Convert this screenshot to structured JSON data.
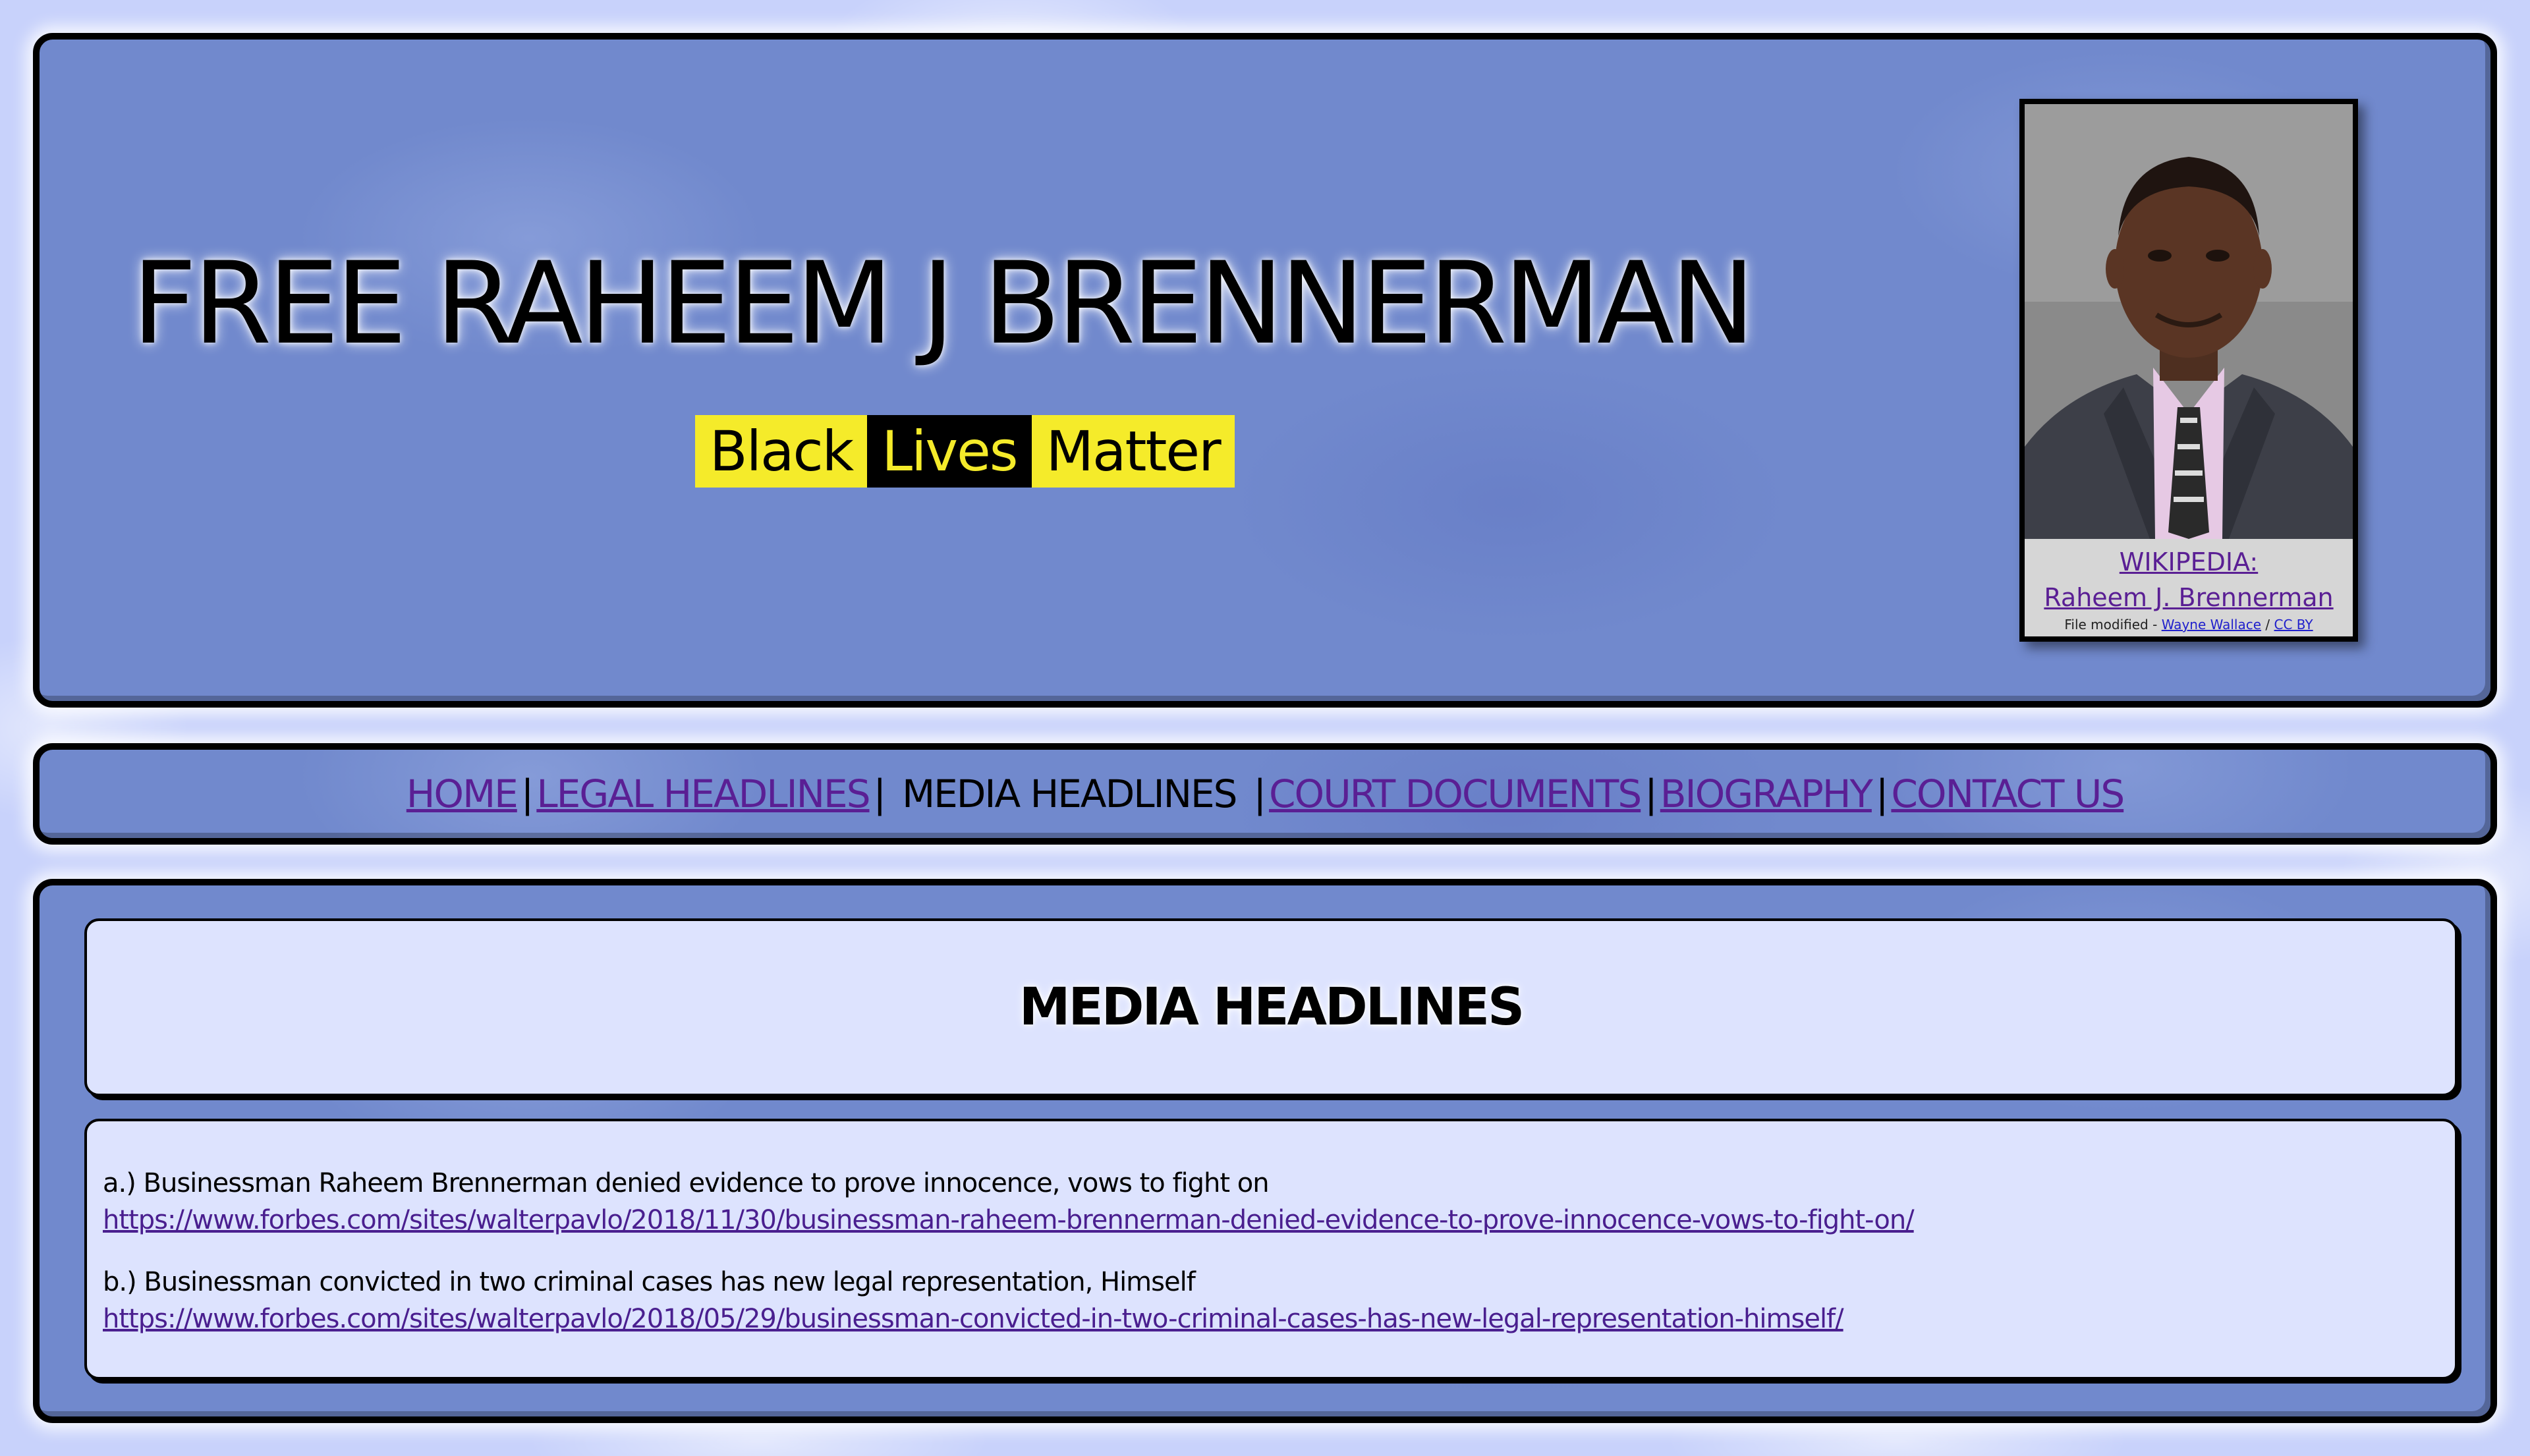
{
  "header": {
    "title": "FREE RAHEEM J BRENNERMAN",
    "badge": {
      "word1": "Black",
      "word2": "Lives",
      "word3": "Matter"
    },
    "photo_card": {
      "wiki_prefix": "WIKIPEDIA:",
      "wiki_name": "Raheem J. Brennerman",
      "credit_text": "File modified - ",
      "credit_author": "Wayne Wallace",
      "credit_sep": " / ",
      "credit_license": "CC BY"
    }
  },
  "nav": {
    "separator": "|",
    "items": [
      {
        "label": "HOME"
      },
      {
        "label": "LEGAL HEADLINES"
      },
      {
        "label": "MEDIA HEADLINES"
      },
      {
        "label": "COURT DOCUMENTS"
      },
      {
        "label": "BIOGRAPHY"
      },
      {
        "label": "CONTACT US"
      }
    ]
  },
  "main": {
    "heading": "MEDIA HEADLINES",
    "items": [
      {
        "text": "a.) Businessman Raheem Brennerman denied evidence to prove innocence, vows to fight on",
        "url": "https://www.forbes.com/sites/walterpavlo/2018/11/30/businessman-raheem-brennerman-denied-evidence-to-prove-innocence-vows-to-fight-on/"
      },
      {
        "text": "b.) Businessman convicted in two criminal cases has new legal representation, Himself",
        "url": "https://www.forbes.com/sites/walterpavlo/2018/05/29/businessman-convicted-in-two-criminal-cases-has-new-legal-representation-himself/"
      }
    ]
  },
  "colors": {
    "panel": "#7189cd",
    "background": "#c8d2fb",
    "link": "#5a1f94",
    "badge_yellow": "#f5eb2a",
    "content_box": "#dde3fe"
  }
}
